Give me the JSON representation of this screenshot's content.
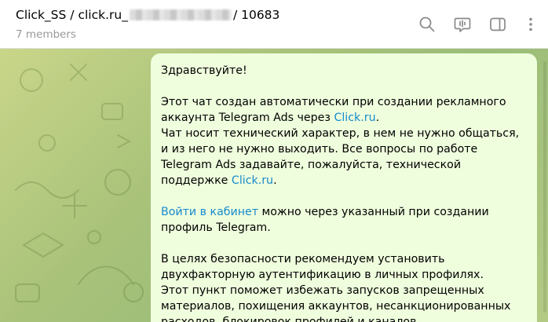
{
  "header": {
    "title_prefix": "Click_SS / click.ru_",
    "title_suffix": " / 10683",
    "members": "7 members",
    "icons": [
      "search-icon",
      "video-chat-icon",
      "sidebar-toggle-icon",
      "more-vert-icon"
    ]
  },
  "message": {
    "greeting": "Здравствуйте!",
    "p1_text": "Этот чат создан автоматически при создании рекламного аккаунта Telegram Ads через ",
    "p1_link": "Click.ru",
    "p1_end": ".",
    "p2_text": "Чат носит технический характер, в нем не нужно общаться, и из него не нужно выходить. Все вопросы по работе Telegram Ads задавайте, пожалуйста, технической поддержке ",
    "p2_link": "Click.ru",
    "p2_end": ".",
    "p3_link": "Войти в кабинет",
    "p3_text": " можно через указанный при создании профиль Telegram.",
    "p4_text": "В целях безопасности рекомендуем установить двухфакторную аутентификацию в личных профилях.",
    "p5_text": "Этот пункт поможет избежать запусков запрещенных материалов, похищения аккаунтов, несанкционированных расходов, блокировок профилей и каналов."
  },
  "colors": {
    "link": "#168acd",
    "bubble": "#effedd",
    "header_bg": "#ffffff",
    "muted": "#999999"
  }
}
